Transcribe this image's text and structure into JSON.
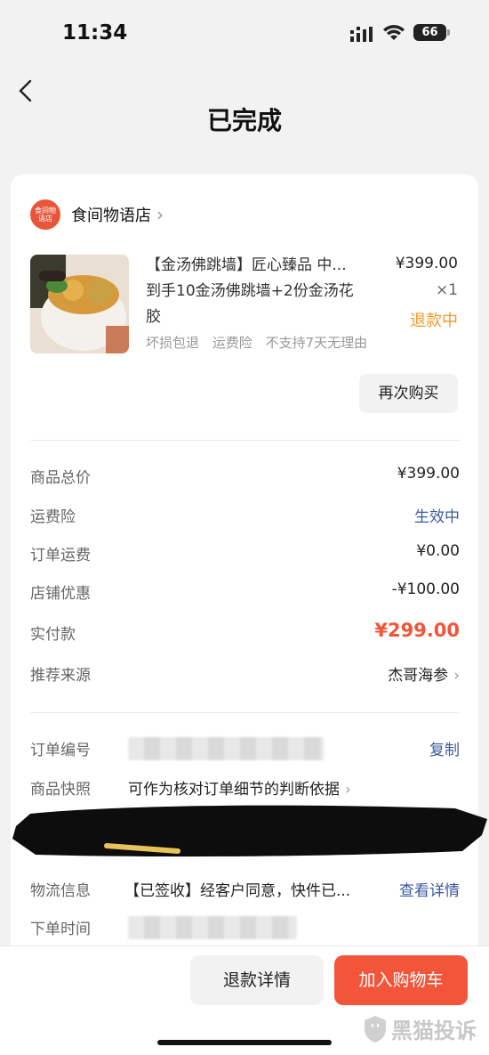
{
  "status_bar": {
    "time": "11:34",
    "battery": "66"
  },
  "header": {
    "title": "已完成"
  },
  "shop": {
    "logo_text": "食间物语店",
    "name": "食间物语店"
  },
  "product": {
    "title_line1": "【金汤佛跳墙】匠心臻品 中...",
    "title_line2": "到手10金汤佛跳墙+2份金汤花",
    "title_line3": "胶",
    "price": "¥399.00",
    "quantity": "×1",
    "refund_status": "退款中",
    "tags": [
      "坏损包退",
      "运费险",
      "不支持7天无理由"
    ],
    "rebuy_label": "再次购买"
  },
  "summary": [
    {
      "label": "商品总价",
      "value": "¥399.00"
    },
    {
      "label": "运费险",
      "value": "生效中"
    },
    {
      "label": "订单运费",
      "value": "¥0.00"
    },
    {
      "label": "店铺优惠",
      "value": "-¥100.00"
    },
    {
      "label": "实付款",
      "value": "¥299.00"
    },
    {
      "label": "推荐来源",
      "value": "杰哥海参"
    }
  ],
  "order_info": {
    "order_no_label": "订单编号",
    "copy_label": "复制",
    "snapshot_label": "商品快照",
    "snapshot_text": "可作为核对订单细节的判断依据",
    "logistics_label": "物流信息",
    "logistics_text": "【已签收】经客户同意，快件已...",
    "logistics_link": "查看详情",
    "order_time_label": "下单时间"
  },
  "bottom": {
    "refund_detail": "退款详情",
    "add_cart": "加入购物车"
  },
  "watermark": "黑猫投诉",
  "colors": {
    "accent": "#f2553a",
    "link": "#3b5a9c",
    "refund": "#f29a2e"
  }
}
